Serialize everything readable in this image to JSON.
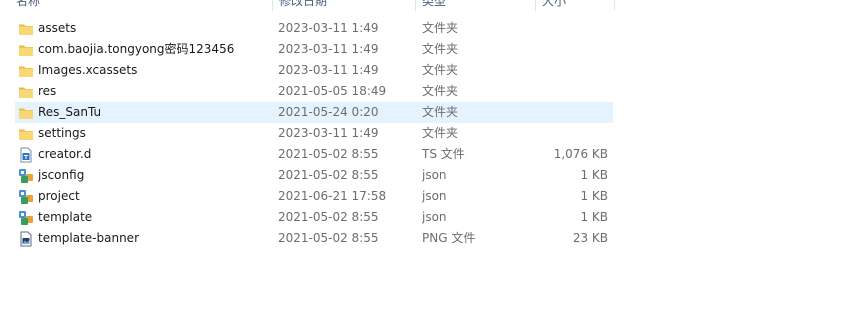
{
  "header": {
    "name": "名称",
    "date": "修改日期",
    "type": "类型",
    "size": "大小"
  },
  "rows": [
    {
      "name": "assets",
      "date": "2023-03-11 1:49",
      "type": "文件夹",
      "size": "",
      "icon": "folder-icon"
    },
    {
      "name": "com.baojia.tongyong密码123456",
      "date": "2023-03-11 1:49",
      "type": "文件夹",
      "size": "",
      "icon": "folder-icon"
    },
    {
      "name": "Images.xcassets",
      "date": "2023-03-11 1:49",
      "type": "文件夹",
      "size": "",
      "icon": "folder-icon"
    },
    {
      "name": "res",
      "date": "2021-05-05 18:49",
      "type": "文件夹",
      "size": "",
      "icon": "folder-icon"
    },
    {
      "name": "Res_SanTu",
      "date": "2021-05-24 0:20",
      "type": "文件夹",
      "size": "",
      "icon": "folder-icon",
      "selected": true
    },
    {
      "name": "settings",
      "date": "2023-03-11 1:49",
      "type": "文件夹",
      "size": "",
      "icon": "folder-icon"
    },
    {
      "name": "creator.d",
      "date": "2021-05-02 8:55",
      "type": "TS 文件",
      "size": "1,076 KB",
      "icon": "ts-file-icon"
    },
    {
      "name": "jsconfig",
      "date": "2021-05-02 8:55",
      "type": "json",
      "size": "1 KB",
      "icon": "json-file-icon"
    },
    {
      "name": "project",
      "date": "2021-06-21 17:58",
      "type": "json",
      "size": "1 KB",
      "icon": "json-file-icon"
    },
    {
      "name": "template",
      "date": "2021-05-02 8:55",
      "type": "json",
      "size": "1 KB",
      "icon": "json-file-icon"
    },
    {
      "name": "template-banner",
      "date": "2021-05-02 8:55",
      "type": "PNG 文件",
      "size": "23 KB",
      "icon": "png-file-icon"
    }
  ],
  "colors": {
    "selection": "#e5f3ff",
    "folder": "#f8d775",
    "header_text": "#4c607a",
    "secondary_text": "#6d6d6d"
  }
}
